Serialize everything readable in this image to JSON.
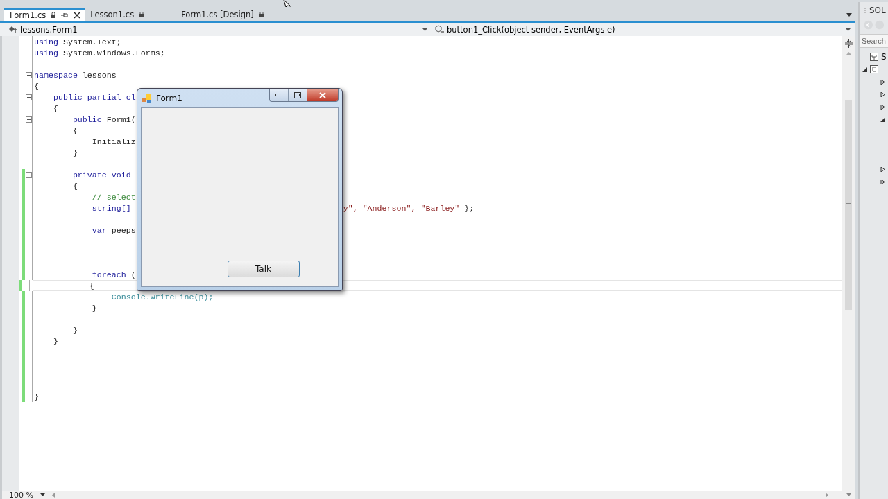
{
  "tabs": [
    {
      "label": "Form1.cs",
      "selected": true,
      "pinned": true,
      "closable": true
    },
    {
      "label": "Lesson1.cs",
      "selected": false,
      "pinned": false,
      "closable": false
    },
    {
      "label": "Form1.cs [Design]",
      "selected": false,
      "pinned": false,
      "closable": false
    }
  ],
  "nav_bar": {
    "type_selector": "lessons.Form1",
    "member_selector": "button1_Click(object sender, EventArgs e)"
  },
  "code_lines": [
    {
      "tokens": [
        {
          "text": "using",
          "kind": "keyword"
        },
        {
          "text": "System.Text;",
          "kind": "plain"
        }
      ],
      "changed": false,
      "current": false
    },
    {
      "tokens": [
        {
          "text": "using",
          "kind": "keyword"
        },
        {
          "text": "System.Windows.Forms;",
          "kind": "plain"
        }
      ],
      "changed": false,
      "current": false
    },
    {
      "changed": false,
      "current": false
    },
    {
      "tokens": [
        {
          "text": "namespace",
          "kind": "keyword"
        },
        {
          "text": "lessons",
          "kind": "plain"
        }
      ],
      "expanded": true,
      "changed": false,
      "current": false
    },
    {
      "tokens": [
        {
          "text": "{",
          "kind": "plain"
        }
      ],
      "changed": false,
      "current": false,
      "children": [
        {
          "tokens": [
            {
              "text": "public",
              "kind": "keyword"
            },
            {
              "text": "partial",
              "kind": "keyword"
            },
            {
              "text": "cl",
              "kind": "keyword"
            }
          ],
          "expanded": true,
          "changed": false,
          "current": false
        },
        {
          "tokens": [
            {
              "text": "{",
              "kind": "plain"
            }
          ],
          "changed": false,
          "current": false,
          "children": [
            {
              "tokens": [
                {
                  "text": "public",
                  "kind": "keyword"
                },
                {
                  "text": "Form1(",
                  "kind": "plain"
                }
              ],
              "expanded": true,
              "changed": false,
              "current": false
            },
            {
              "tokens": [
                {
                  "text": "{",
                  "kind": "plain"
                }
              ],
              "changed": false,
              "current": false,
              "children": [
                {
                  "tokens": [
                    {
                      "text": "Initializ",
                      "kind": "plain"
                    }
                  ],
                  "changed": false,
                  "current": false
                }
              ]
            },
            {
              "tokens": [
                {
                  "text": "}",
                  "kind": "plain"
                }
              ],
              "changed": false,
              "current": false
            },
            {
              "changed": false,
              "current": false
            },
            {
              "tokens": [
                {
                  "text": "private",
                  "kind": "keyword"
                },
                {
                  "text": "void",
                  "kind": "keyword"
                }
              ],
              "expanded": true,
              "changed": true,
              "current": false
            },
            {
              "tokens": [
                {
                  "text": "{",
                  "kind": "plain"
                }
              ],
              "changed": true,
              "current": false,
              "children": [
                {
                  "tokens": [
                    {
                      "text": "// select",
                      "kind": "comment"
                    }
                  ],
                  "changed": true,
                  "current": false
                },
                {
                  "tokens": [
                    {
                      "text": "string[]",
                      "kind": "keyword"
                    }
                  ],
                  "tail": [
                    {
                      "text": "y\",",
                      "kind": "string"
                    },
                    {
                      "text": "\"Anderson\",",
                      "kind": "string"
                    },
                    {
                      "text": "\"Barley\"",
                      "kind": "string"
                    },
                    {
                      "text": "};",
                      "kind": "plain"
                    }
                  ],
                  "changed": true,
                  "current": false
                },
                {
                  "changed": true,
                  "current": false
                },
                {
                  "tokens": [
                    {
                      "text": "var",
                      "kind": "keyword"
                    },
                    {
                      "text": "peeps",
                      "kind": "plain"
                    }
                  ],
                  "changed": true,
                  "current": false
                },
                {
                  "changed": true,
                  "current": false
                },
                {
                  "changed": true,
                  "current": false
                },
                {
                  "changed": true,
                  "current": false
                },
                {
                  "tokens": [
                    {
                      "text": "foreach",
                      "kind": "keyword"
                    },
                    {
                      "text": "(",
                      "kind": "plain"
                    }
                  ],
                  "changed": true,
                  "current": false
                },
                {
                  "tokens": [
                    {
                      "text": "{",
                      "kind": "plain"
                    }
                  ],
                  "changed": true,
                  "current": true,
                  "children": [
                    {
                      "tokens": [
                        {
                          "text": "Console.WriteLine(p);",
                          "kind": "type"
                        }
                      ],
                      "changed": true,
                      "current": false
                    }
                  ]
                },
                {
                  "tokens": [
                    {
                      "text": "}",
                      "kind": "plain"
                    }
                  ],
                  "changed": true,
                  "current": false
                },
                {
                  "changed": true,
                  "current": false
                }
              ]
            },
            {
              "tokens": [
                {
                  "text": "}",
                  "kind": "plain"
                }
              ],
              "changed": true,
              "current": false
            }
          ]
        },
        {
          "tokens": [
            {
              "text": "}",
              "kind": "plain"
            }
          ],
          "changed": true,
          "current": false
        },
        {
          "changed": true,
          "current": false
        },
        {
          "changed": true,
          "current": false
        },
        {
          "changed": true,
          "current": false
        },
        {
          "changed": true,
          "current": false
        }
      ]
    },
    {
      "tokens": [
        {
          "text": "}",
          "kind": "plain"
        }
      ],
      "changed": true,
      "current": false
    }
  ],
  "zoom": "100 %",
  "form_window": {
    "title": "Form1",
    "button": "Talk"
  },
  "solution_panel": {
    "title": "SOL",
    "search": {
      "placeholder": "Search"
    },
    "items": [
      {
        "label": "S",
        "kind": "solution"
      },
      {
        "kind": "project",
        "expanded": true
      },
      {
        "kind": "node",
        "expanded": false
      },
      {
        "kind": "node",
        "expanded": false
      },
      {
        "kind": "node",
        "expanded": false
      },
      {
        "kind": "node",
        "expanded": true
      },
      {
        "kind": "gap"
      },
      {
        "kind": "gap"
      },
      {
        "kind": "gap"
      },
      {
        "kind": "node",
        "expanded": false
      },
      {
        "kind": "node",
        "expanded": false
      }
    ]
  }
}
